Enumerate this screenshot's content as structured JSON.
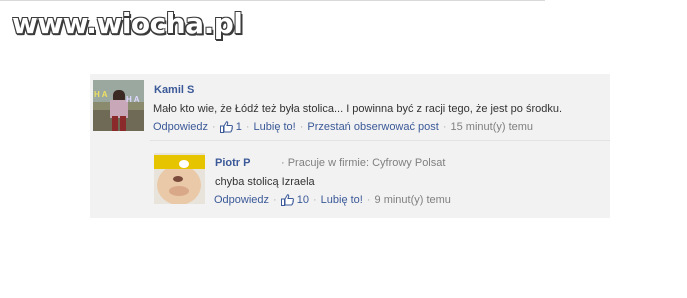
{
  "watermark": {
    "text": "www.wiocha.pl"
  },
  "comments": [
    {
      "author": "Kamil S",
      "text": "Mało kto wie, że Łódź też była stolica... I powinna być z racji tego, że jest po środku.",
      "reply_label": "Odpowiedz",
      "like_count": "1",
      "like_label": "Lubię to!",
      "follow_label": "Przestań obserwować post",
      "time": "15 minut(y) temu",
      "avatar_overlay": "H A",
      "avatar_overlay_2": "H A"
    },
    {
      "author": "Piotr P",
      "work": "· Pracuje w firmie: Cyfrowy Polsat",
      "text": "chyba stolicą Izraela",
      "reply_label": "Odpowiedz",
      "like_count": "10",
      "like_label": "Lubię to!",
      "time": "9 minut(y) temu"
    }
  ],
  "colors": {
    "link": "#3b5998",
    "meta": "#808080",
    "box_bg": "#f2f2f2"
  },
  "icons": [
    "like-thumb-icon"
  ]
}
